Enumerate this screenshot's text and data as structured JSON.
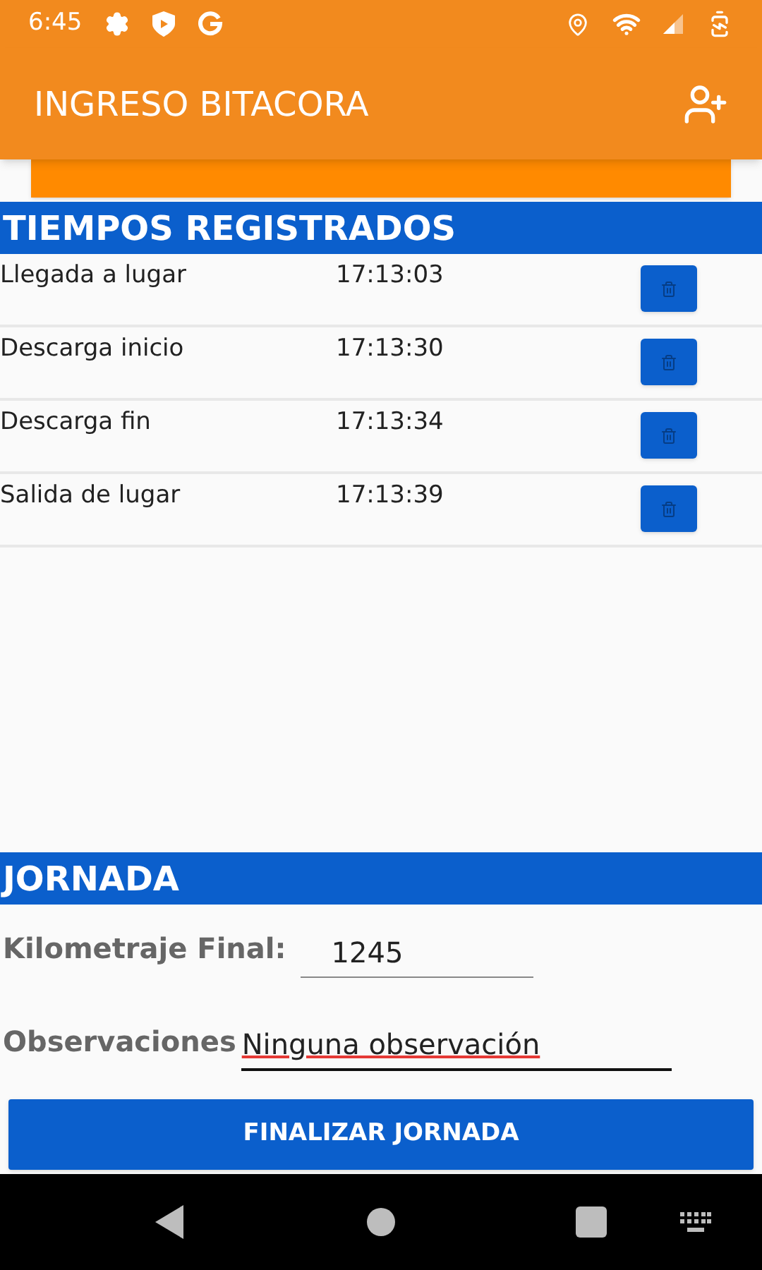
{
  "status_bar": {
    "time": "6:45"
  },
  "app_bar": {
    "title": "INGRESO BITACORA"
  },
  "times_section": {
    "title": "TIEMPOS REGISTRADOS",
    "rows": [
      {
        "event": "Llegada a lugar",
        "time": "17:13:03"
      },
      {
        "event": "Descarga inicio",
        "time": "17:13:30"
      },
      {
        "event": "Descarga fin",
        "time": "17:13:34"
      },
      {
        "event": "Salida de lugar",
        "time": "17:13:39"
      }
    ]
  },
  "day_section": {
    "title": "JORNADA",
    "mileage_label": "Kilometraje Final:",
    "mileage_value": "1245",
    "notes_label": "Observaciones",
    "notes_value": "Ninguna observación",
    "notes_focused": true
  },
  "finish_button": "FINALIZAR JORNADA"
}
